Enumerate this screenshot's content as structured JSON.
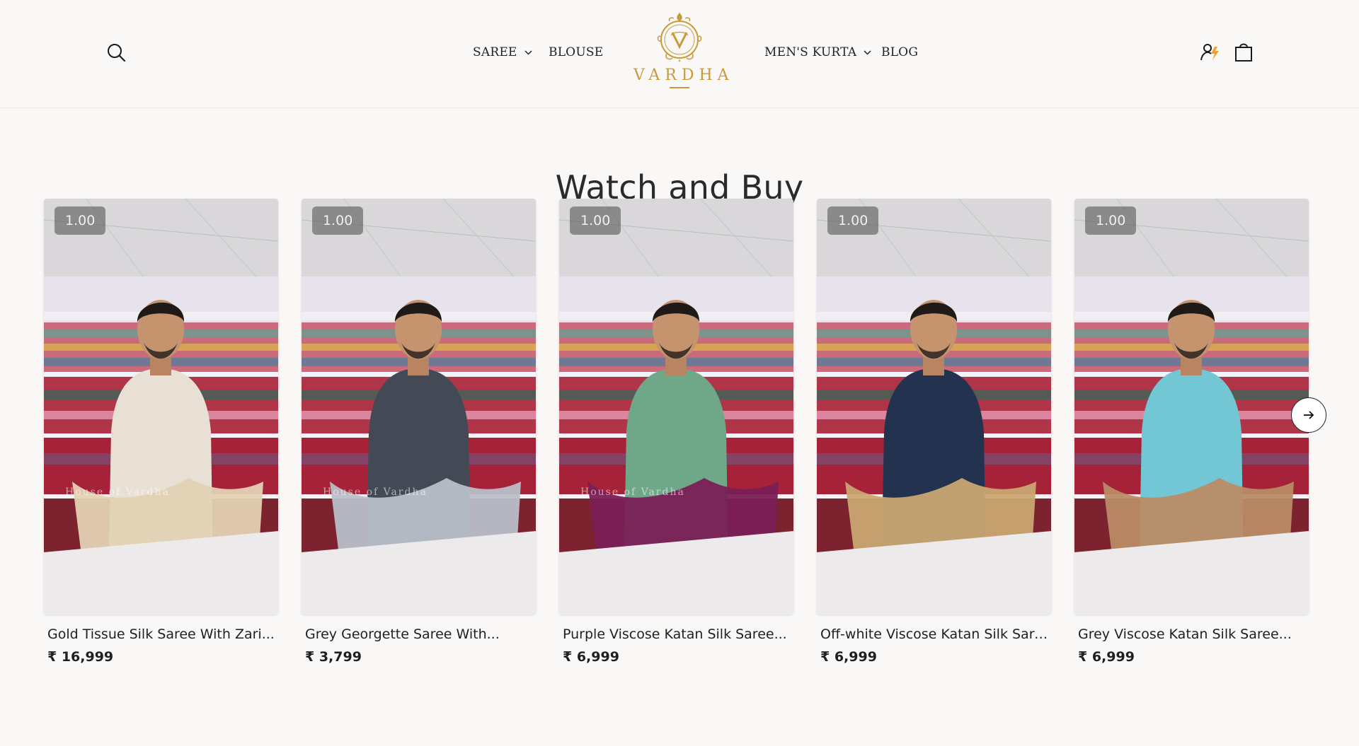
{
  "header": {
    "nav_left": [
      {
        "label": "SAREE",
        "has_dropdown": true
      },
      {
        "label": "BLOUSE",
        "has_dropdown": false
      }
    ],
    "nav_right": [
      {
        "label": "MEN'S KURTA",
        "has_dropdown": true
      },
      {
        "label": "BLOG",
        "has_dropdown": false
      }
    ],
    "logo_text": "VARDHA",
    "icons": {
      "search": "search-icon",
      "account": "account-icon",
      "cart": "shopping-bag-icon",
      "dropdown": "chevron-down-icon",
      "logo": "monogram-v-crest-icon"
    }
  },
  "section": {
    "title": "Watch and Buy"
  },
  "products": [
    {
      "title": "Gold Tissue Silk Saree With Zari...",
      "price": "₹ 16,999",
      "speed": "1.00",
      "watermark": "House of Vardha",
      "kurta_color": "#e8e0d4",
      "fabric_color": "#e3d2b4"
    },
    {
      "title": "Grey Georgette Saree With...",
      "price": "₹ 3,799",
      "speed": "1.00",
      "watermark": "House of Vardha",
      "kurta_color": "#444a55",
      "fabric_color": "#b9bfc8"
    },
    {
      "title": "Purple Viscose Katan Silk Saree...",
      "price": "₹ 6,999",
      "speed": "1.00",
      "watermark": "House of Vardha",
      "kurta_color": "#6fa889",
      "fabric_color": "#7a1f55"
    },
    {
      "title": "Off-white Viscose Katan Silk Sare...",
      "price": "₹ 6,999",
      "speed": "1.00",
      "watermark": "",
      "kurta_color": "#23324f",
      "fabric_color": "#c9a771"
    },
    {
      "title": "Grey Viscose Katan Silk Saree...",
      "price": "₹ 6,999",
      "speed": "1.00",
      "watermark": "",
      "kurta_color": "#73c6d3",
      "fabric_color": "#b98c66"
    }
  ],
  "carousel": {
    "next_icon": "arrow-right-icon"
  },
  "colors": {
    "brand_gold": "#c89a3a",
    "background": "#f9f8f6",
    "text": "#1f1f1f"
  }
}
